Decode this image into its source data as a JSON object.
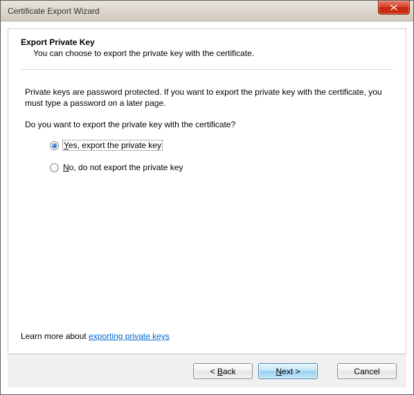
{
  "window": {
    "title": "Certificate Export Wizard"
  },
  "header": {
    "title": "Export Private Key",
    "subtitle": "You can choose to export the private key with the certificate."
  },
  "body": {
    "explain": "Private keys are password protected. If you want to export the private key with the certificate, you must type a password on a later page.",
    "question": "Do you want to export the private key with the certificate?",
    "options": {
      "yes": {
        "hot": "Y",
        "rest": "es, export the private key",
        "selected": true
      },
      "no": {
        "hot": "N",
        "rest": "o, do not export the private key",
        "selected": false
      }
    }
  },
  "learn": {
    "prefix": "Learn more about ",
    "link": "exporting private keys"
  },
  "buttons": {
    "back_hot": "B",
    "back_prefix": "< ",
    "back_rest": "ack",
    "next_hot": "N",
    "next_rest": "ext >",
    "cancel": "Cancel"
  }
}
